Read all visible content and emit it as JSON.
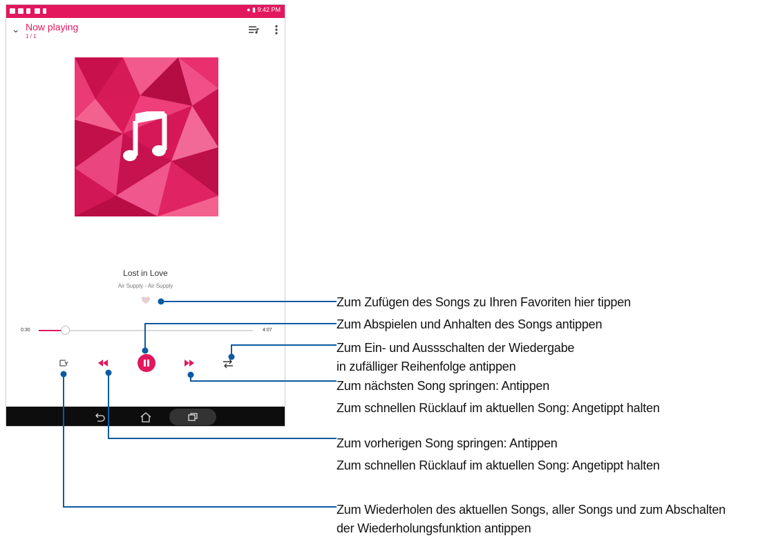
{
  "status_bar": {
    "time": "9:42 PM"
  },
  "header": {
    "title": "Now playing",
    "track_count": "1 / 1"
  },
  "track": {
    "title": "Lost in Love",
    "artist_album": "Air Supply - Air Supply",
    "favorite": false
  },
  "progress": {
    "elapsed": "0:30",
    "total": "4:07",
    "fraction": 0.121
  },
  "player": {
    "state": "playing"
  },
  "icons": {
    "header": [
      "chevron-down-icon",
      "queue-icon",
      "more-vert-icon"
    ],
    "controls": [
      "repeat-icon",
      "previous-icon",
      "pause-icon",
      "next-icon",
      "shuffle-icon"
    ],
    "nav": [
      "back-icon",
      "home-icon",
      "recent-apps-icon"
    ]
  },
  "colors": {
    "accent": "#e2175e",
    "callout_line": "#0b5aa2"
  },
  "callouts": [
    {
      "id": "favorite",
      "lines": [
        "Zum Zufügen des Songs zu Ihren Favoriten hier tippen"
      ]
    },
    {
      "id": "play_pause",
      "lines": [
        "Zum Abspielen und Anhalten des Songs antippen"
      ]
    },
    {
      "id": "shuffle",
      "lines": [
        "Zum Ein- und Aussschalten der Wiedergabe",
        "in zufälliger Reihenfolge antippen"
      ]
    },
    {
      "id": "next",
      "lines": [
        "Zum nächsten Song springen: Antippen",
        "Zum schnellen Rücklauf im aktuellen Song: Angetippt halten"
      ]
    },
    {
      "id": "previous",
      "lines": [
        "Zum vorherigen Song springen: Antippen",
        "Zum schnellen Rücklauf im aktuellen Song: Angetippt halten"
      ]
    },
    {
      "id": "repeat",
      "lines": [
        "Zum Wiederholen des aktuellen Songs, aller Songs und zum Abschalten",
        "der Wiederholungsfunktion antippen"
      ]
    }
  ]
}
